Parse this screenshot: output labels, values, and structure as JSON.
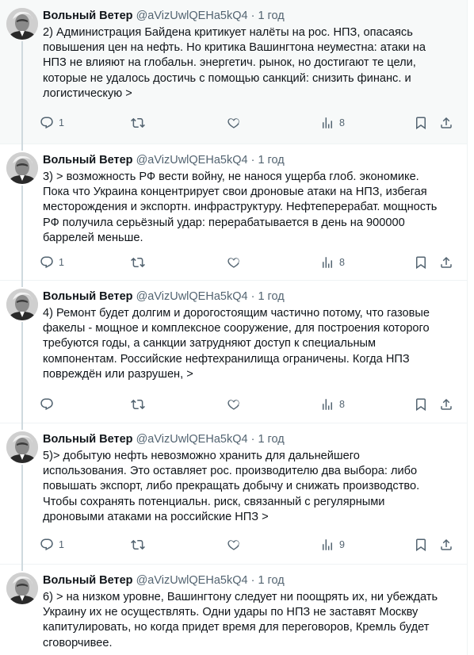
{
  "tweets": [
    {
      "name": "Вольный Ветер",
      "handle": "@aVizUwlQEHa5kQ4",
      "separator": "·",
      "time": "1 год",
      "text": "2) Администрация Байдена критикует налёты на рос. НПЗ, опасаясь\nповышения цен на нефть. Но критика Вашингтона неуместна: атаки на\nНПЗ не влияют на глобальн. энергетич. рынок, но достигают те цели,\nкоторые не удалось достичь с помощью санкций: снизить финанс. и\nлогистическую >",
      "replies": "1",
      "retweets": "",
      "likes": "",
      "views": "8",
      "highlighted": true
    },
    {
      "name": "Вольный Ветер",
      "handle": "@aVizUwlQEHa5kQ4",
      "separator": "·",
      "time": "1 год",
      "text": "3) > возможность РФ вести войну, не нанося ущерба глоб. экономике.\nПока что Украина концентрирует свои дроновые атаки на НПЗ, избегая\nместорождения и экспортн. инфраструктуру. Нефтеперерабат. мощность\nРФ получила серьёзный удар: перерабатывается в день на 900000\nбаррелей меньше.",
      "replies": "1",
      "retweets": "",
      "likes": "",
      "views": "8",
      "highlighted": false
    },
    {
      "name": "Вольный Ветер",
      "handle": "@aVizUwlQEHa5kQ4",
      "separator": "·",
      "time": "1 год",
      "text": "4) Ремонт будет долгим и дорогостоящим частично потому, что газовые\nфакелы - мощное и комплексное сооружение, для построения которого\nтребуются годы, а санкции затрудняют доступ к специальным\nкомпонентам. Российские нефтехранилища ограничены. Когда НПЗ\nповреждён или разрушен, >",
      "replies": "",
      "retweets": "",
      "likes": "",
      "views": "8",
      "highlighted": false
    },
    {
      "name": "Вольный Ветер",
      "handle": "@aVizUwlQEHa5kQ4",
      "separator": "·",
      "time": "1 год",
      "text": "5)> добытую нефть невозможно хранить для дальнейшего\nиспользования. Это оставляет рос. производителю два выбора: либо\nповышать экспорт, либо прекращать добычу и снижать производство.\nЧтобы сохранять потенциальн. риск, связанный с регулярными\nдроновыми атаками на российские НПЗ >",
      "replies": "1",
      "retweets": "",
      "likes": "",
      "views": "9",
      "highlighted": false
    },
    {
      "name": "Вольный Ветер",
      "handle": "@aVizUwlQEHa5kQ4",
      "separator": "·",
      "time": "1 год",
      "text": "6) > на низком уровне, Вашингтону следует ни поощрять их, ни убеждать\nУкраину их не осуществлять. Одни удары по НПЗ не заставят Москву\nкапитулировать, но когда придет время для переговоров, Кремль будет\nсговорчивее.",
      "replies": "",
      "retweets": "",
      "likes": "",
      "views": "",
      "highlighted": false
    }
  ],
  "icons": {
    "reply": "reply-icon",
    "retweet": "retweet-icon",
    "like": "heart-icon",
    "views": "views-icon",
    "bookmark": "bookmark-icon",
    "share": "share-icon"
  },
  "colors": {
    "muted": "#536471",
    "text": "#0f1419",
    "highlight_bg": "#f7f9f9",
    "thread_line": "#cfd9de"
  }
}
